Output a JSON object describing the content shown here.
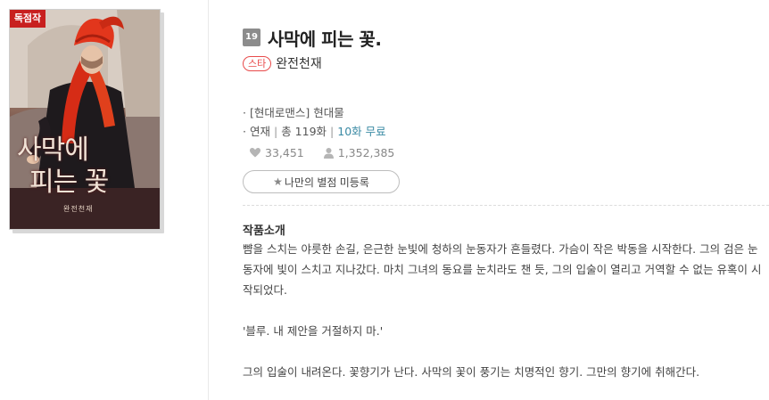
{
  "cover": {
    "badge": "독점작",
    "title_line1": "사막에",
    "title_line2": "피는 꽃",
    "subtitle": "완전천재"
  },
  "work": {
    "age_rating": "19",
    "title": "사막에 피는 꽃.",
    "star_tag": "스타",
    "author": "완전천재",
    "genre_prefix": "·",
    "genre": "[현대로맨스] 현대물",
    "serial_prefix": "·",
    "status": "연재",
    "total": "총 119화",
    "free": "10화 무료",
    "likes": "33,451",
    "readers": "1,352,385",
    "bookshelf_button": "나만의 별점 미등록"
  },
  "intro": {
    "heading": "작품소개",
    "paragraph1": "뺨을 스치는 야릇한 손길, 은근한 눈빛에 청하의 눈동자가 흔들렸다. 가슴이 작은 박동을 시작한다. 그의 검은 눈동자에 빛이 스치고 지나갔다. 마치 그녀의 동요를 눈치라도 챈 듯, 그의 입술이 열리고 거역할 수 없는 유혹이 시작되었다.",
    "paragraph2": "'블루. 내 제안을 거절하지 마.'",
    "paragraph3": "그의 입술이 내려온다. 꽃향기가 난다. 사막의 꽃이 풍기는 치명적인 향기. 그만의 향기에 취해간다."
  },
  "icons": {
    "likes": "heart-icon",
    "readers": "person-icon",
    "bookshelf": "star-icon"
  },
  "colors": {
    "exclusive_badge": "#c8201f",
    "star_tag": "#e84a4a",
    "free_link": "#3a8aa4",
    "age_badge": "#8c8c8c"
  }
}
